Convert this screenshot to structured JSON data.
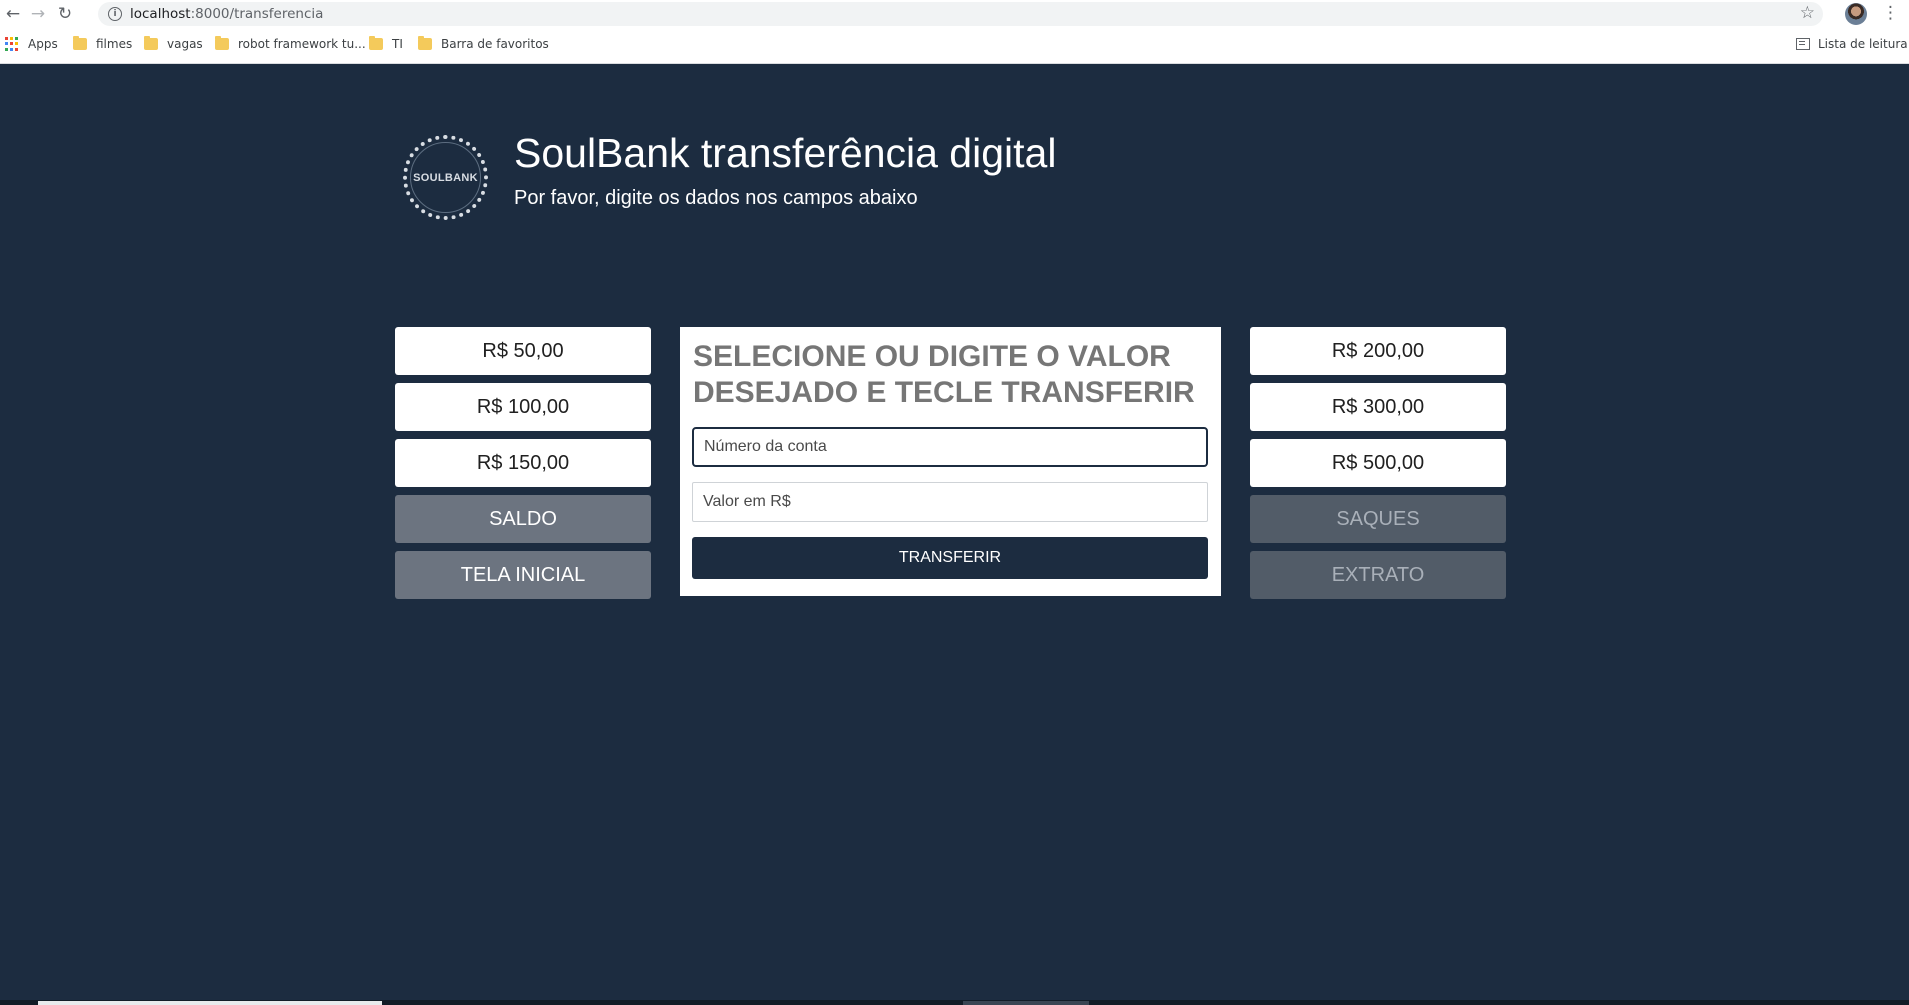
{
  "browser": {
    "url_host": "localhost",
    "url_path": ":8000/transferencia",
    "bookmarks": [
      "Apps",
      "filmes",
      "vagas",
      "robot framework tu...",
      "TI",
      "Barra de favoritos"
    ],
    "reading_list": "Lista de leitura"
  },
  "header": {
    "logo_text": "SOULBANK",
    "title": "SoulBank transferência digital",
    "subtitle": "Por favor, digite os dados nos campos abaixo"
  },
  "left_buttons": [
    "R$ 50,00",
    "R$ 100,00",
    "R$ 150,00",
    "SALDO",
    "TELA INICIAL"
  ],
  "right_buttons": [
    "R$ 200,00",
    "R$ 300,00",
    "R$ 500,00",
    "SAQUES",
    "EXTRATO"
  ],
  "panel": {
    "heading": "SELECIONE OU DIGITE O VALOR DESEJADO E TECLE TRANSFERIR",
    "account_placeholder": "Número da conta",
    "amount_placeholder": "Valor em R$",
    "submit_label": "TRANSFERIR"
  },
  "colors": {
    "background": "#1c2c40",
    "panel": "#ffffff",
    "action_button": "#6c7480",
    "disabled_button": "#525c68",
    "submit": "#1c2c40"
  },
  "icons": [
    "back-arrow-icon",
    "forward-arrow-icon",
    "reload-icon",
    "info-icon",
    "star-icon",
    "menu-kebab-icon",
    "apps-grid-icon",
    "folder-icon",
    "reading-list-icon"
  ]
}
